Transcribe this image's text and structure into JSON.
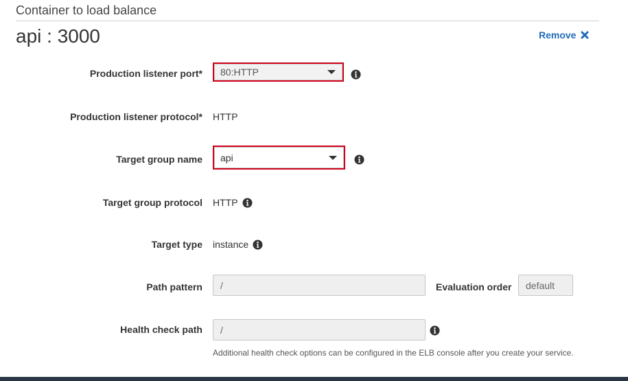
{
  "section": {
    "title": "Container to load balance"
  },
  "container": {
    "name": "api : 3000",
    "remove_label": "Remove"
  },
  "form": {
    "production_listener_port": {
      "label": "Production listener port*",
      "value": "80:HTTP"
    },
    "production_listener_protocol": {
      "label": "Production listener protocol*",
      "value": "HTTP"
    },
    "target_group_name": {
      "label": "Target group name",
      "value": "api"
    },
    "target_group_protocol": {
      "label": "Target group protocol",
      "value": "HTTP"
    },
    "target_type": {
      "label": "Target type",
      "value": "instance"
    },
    "path_pattern": {
      "label": "Path pattern",
      "value": "/"
    },
    "evaluation_order": {
      "label": "Evaluation order",
      "value": "default"
    },
    "health_check_path": {
      "label": "Health check path",
      "value": "/",
      "help": "Additional health check options can be configured in the ELB console after you create your service."
    }
  },
  "icons": {
    "info": "info-circle-icon",
    "remove": "close-x-icon"
  },
  "colors": {
    "link": "#1e6bb8",
    "highlight_border": "#d0021b",
    "footer": "#2b3645"
  }
}
